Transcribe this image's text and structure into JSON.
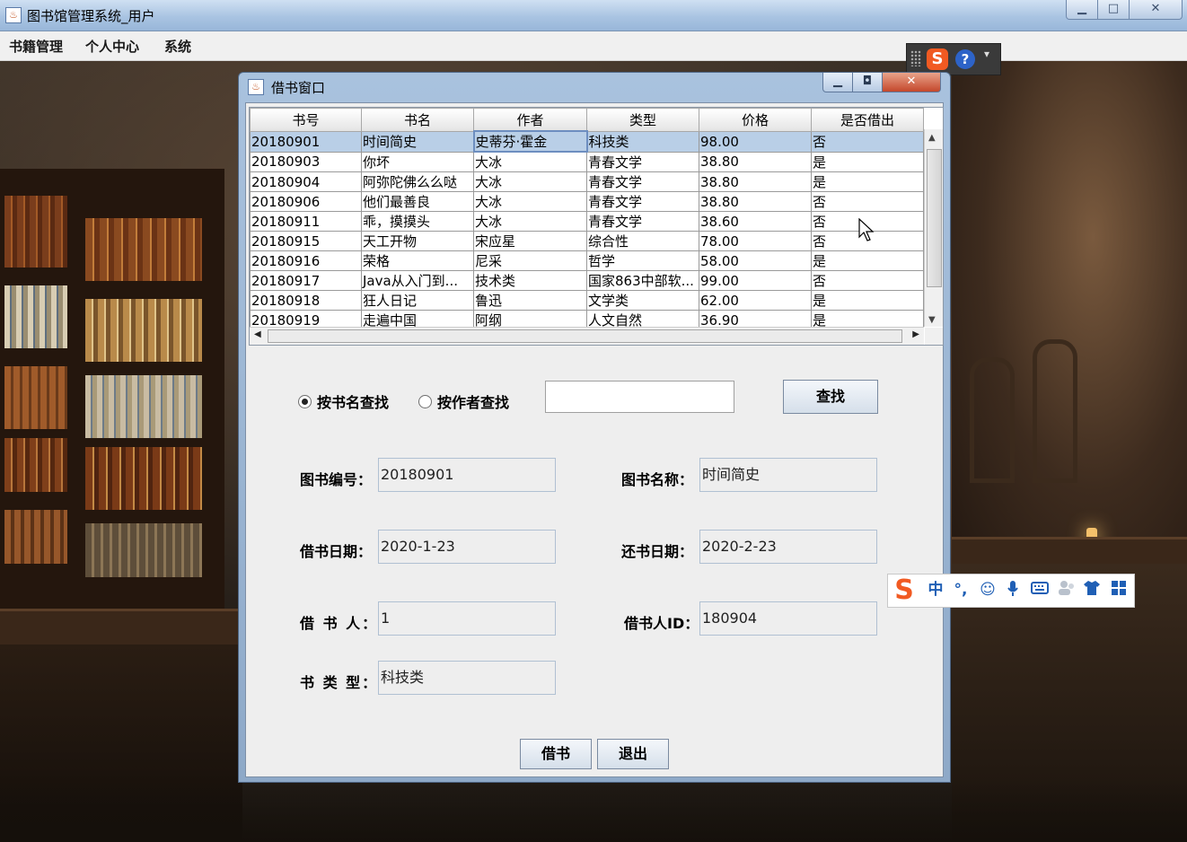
{
  "window": {
    "title": "图书馆管理系统_用户",
    "min_label": "▁",
    "max_label": "□",
    "close_label": "✕"
  },
  "menubar": {
    "items": [
      "书籍管理",
      "个人中心",
      "系统"
    ]
  },
  "dialog": {
    "title": "借书窗口",
    "table": {
      "columns": [
        "书号",
        "书名",
        "作者",
        "类型",
        "价格",
        "是否借出"
      ],
      "rows": [
        [
          "20180901",
          "时间简史",
          "史蒂芬·霍金",
          "科技类",
          "98.00",
          "否"
        ],
        [
          "20180903",
          "你坏",
          "大冰",
          "青春文学",
          "38.80",
          "是"
        ],
        [
          "20180904",
          "阿弥陀佛么么哒",
          "大冰",
          "青春文学",
          "38.80",
          "是"
        ],
        [
          "20180906",
          "他们最善良",
          "大冰",
          "青春文学",
          "38.80",
          "否"
        ],
        [
          "20180911",
          "乖，摸摸头",
          "大冰",
          "青春文学",
          "38.60",
          "否"
        ],
        [
          "20180915",
          "天工开物",
          "宋应星",
          "综合性",
          "78.00",
          "否"
        ],
        [
          "20180916",
          "荣格",
          "尼采",
          "哲学",
          "58.00",
          "是"
        ],
        [
          "20180917",
          "Java从入门到...",
          "技术类",
          "国家863中部软...",
          "99.00",
          "否"
        ],
        [
          "20180918",
          "狂人日记",
          "鲁迅",
          "文学类",
          "62.00",
          "是"
        ],
        [
          "20180919",
          "走遍中国",
          "阿纲",
          "人文自然",
          "36.90",
          "是"
        ]
      ],
      "selected_row": 0
    },
    "search": {
      "by_title_label": "按书名查找",
      "by_author_label": "按作者查找",
      "selected": "by_title",
      "query": "",
      "button_label": "查找"
    },
    "form": {
      "book_id_label": "图书编号：",
      "book_id": "20180901",
      "book_name_label": "图书名称：",
      "book_name": "时间简史",
      "borrow_date_label": "借书日期：",
      "borrow_date": "2020-1-23",
      "return_date_label": "还书日期：",
      "return_date": "2020-2-23",
      "borrower_label": "借 书 人：",
      "borrower": "1",
      "borrower_id_label": "借书人ID：",
      "borrower_id": "180904",
      "book_type_label": "书 类 型：",
      "book_type": "科技类"
    },
    "actions": {
      "borrow_label": "借书",
      "exit_label": "退出"
    }
  },
  "ime": {
    "logo": "S",
    "help": "?",
    "mode": "中",
    "punct": "°,",
    "emoji": "☺",
    "mic": "🎤",
    "keyboard": "⌨",
    "user": "👥",
    "skin": "👕",
    "apps": "▦"
  }
}
